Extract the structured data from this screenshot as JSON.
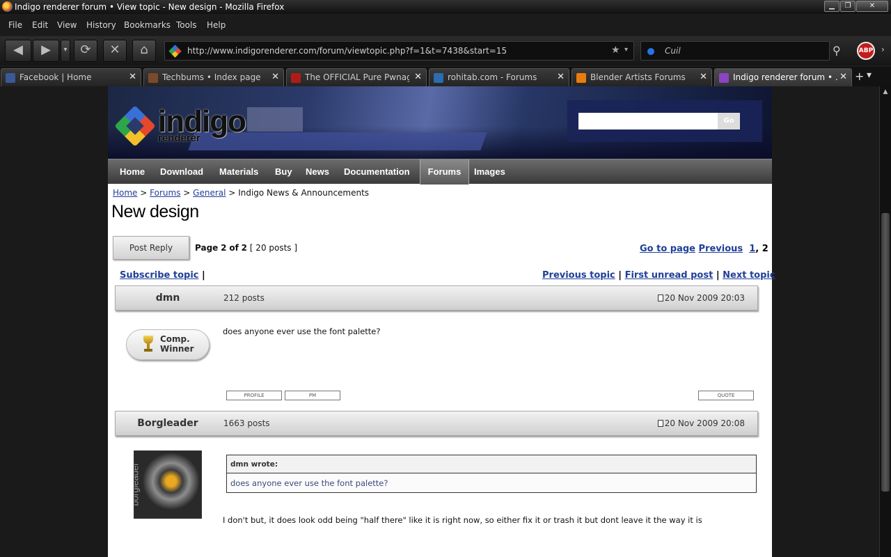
{
  "window": {
    "title": "Indigo renderer forum • View topic - New design - Mozilla Firefox",
    "controls": {
      "minimize": "▁",
      "maximize": "❐",
      "close": "✕"
    }
  },
  "menu": [
    "File",
    "Edit",
    "View",
    "History",
    "Bookmarks",
    "Tools",
    "Help"
  ],
  "navigation": {
    "back_icon": "◀",
    "forward_icon": "▶",
    "dropdown_icon": "▾",
    "reload_icon": "⟳",
    "stop_icon": "✕",
    "home_icon": "⌂",
    "url": "http://www.indigorenderer.com/forum/viewtopic.php?f=1&t=7438&start=15",
    "bookmark_star": "★",
    "search_placeholder": "Cuil",
    "search_icon": "⚲",
    "adblock_label": "ABP",
    "more_icon": "›"
  },
  "tabs": [
    {
      "label": "Facebook | Home",
      "favicon": "facebook-icon",
      "color": "#3b5998",
      "active": false
    },
    {
      "label": "Techbums • Index page",
      "favicon": "techbums-icon",
      "color": "#7a4b2a",
      "active": false
    },
    {
      "label": "The OFFICIAL Pure Pwnag...",
      "favicon": "pure-pwnage-icon",
      "color": "#b21a1a",
      "active": false
    },
    {
      "label": "rohitab.com - Forums",
      "favicon": "rohitab-icon",
      "color": "#2d6cb0",
      "active": false
    },
    {
      "label": "Blender Artists Forums",
      "favicon": "blender-icon",
      "color": "#e87d0d",
      "active": false
    },
    {
      "label": "Indigo renderer forum • ...",
      "favicon": "indigo-icon",
      "color": "#8a44c4",
      "active": true
    }
  ],
  "tab_close": "✕",
  "tab_new": "+",
  "tab_list": "▾",
  "site": {
    "logo_text": "indigo",
    "logo_sub": "renderer",
    "search_go": "Go",
    "nav": [
      "Home",
      "Download",
      "Materials",
      "Buy",
      "News",
      "Documentation",
      "Forums",
      "Images"
    ],
    "active_nav": "Forums"
  },
  "breadcrumb": {
    "home": "Home",
    "forums": "Forums",
    "general": "General",
    "current": "Indigo News & Announcements",
    "sep": ">"
  },
  "topic": {
    "title": "New design",
    "post_reply": "Post Reply",
    "page_label": "Page",
    "page_current": "2",
    "page_of": "of",
    "page_total": "2",
    "posts_count": "[ 20 posts ]",
    "goto_page": "Go to page",
    "previous": "Previous",
    "page_1": "1",
    "page_2": "2",
    "subscribe": "Subscribe topic",
    "previous_topic": "Previous topic",
    "first_unread": "First unread post",
    "next_topic": "Next topic",
    "separator": "|"
  },
  "posts": [
    {
      "author": "dmn",
      "post_count": "212 posts",
      "date": "20 Nov 2009 20:03",
      "rank_badge": "Comp.\nWinner",
      "body": "does anyone ever use the font palette?",
      "buttons": {
        "profile": "PROFILE",
        "pm": "PM",
        "quote": "QUOTE"
      }
    },
    {
      "author": "Borgleader",
      "post_count": "1663 posts",
      "date": "20 Nov 2009 20:08",
      "avatar_text": "borgleader",
      "quote_author": "dmn wrote:",
      "quote_text": "does anyone ever use the font palette?",
      "body": "I don't but, it does look odd being \"half there\" like it is right now, so either fix it or trash it but dont leave it the way it is"
    }
  ],
  "scrollbar": {
    "up_icon": "▲"
  }
}
